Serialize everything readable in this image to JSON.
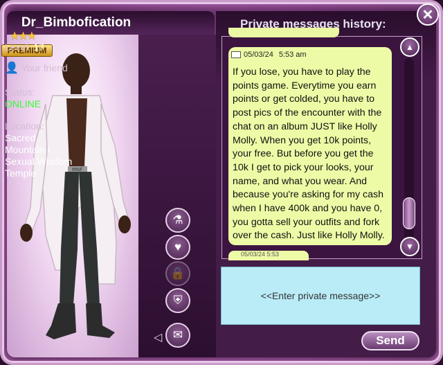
{
  "profile": {
    "username": "Dr_Bimbofication",
    "premium_label": "PREMIUM",
    "premium_stars": "★★★",
    "level_label": "Level:",
    "level_value": "17",
    "friend_label": "Your friend",
    "status_label": "Status:",
    "status_value": "ONLINE",
    "location_label": "Location:",
    "location_value": "Sacred Mountain / Sexual Wisdom Temple",
    "belt_text": "MNF"
  },
  "actions": [
    {
      "name": "perfume-icon",
      "glyph": "⚗"
    },
    {
      "name": "house-heart-icon",
      "glyph": "♥"
    },
    {
      "name": "lock-icon",
      "glyph": "🔒"
    },
    {
      "name": "shield-icon",
      "glyph": "⛨"
    },
    {
      "name": "mail-icon",
      "glyph": "✉"
    }
  ],
  "messages": {
    "header": "Private messages history:",
    "current": {
      "date": "05/03/24",
      "time": "5:53 am",
      "text": "If you lose, you have to play the points game. Everytime you earn points or get colded, you have to post pics of the encounter with the chat on an album JUST like Holly Molly. When you get 10k points, your free. But before you get the 10k I get to pick your looks, your name, and what you wear. And because you're asking for my cash when I have 400k and you have 0, you gotta sell your outfits and fork over the cash. Just like Holly Molly."
    },
    "next_partial": "05/03/24 5:53"
  },
  "input": {
    "placeholder": "<<Enter private message>>"
  },
  "send_label": "Send",
  "close_glyph": "✕",
  "colors": {
    "bubble": "#eefba6",
    "input": "#b9ecf7",
    "online": "#33ff33",
    "panel": "#431c47"
  }
}
